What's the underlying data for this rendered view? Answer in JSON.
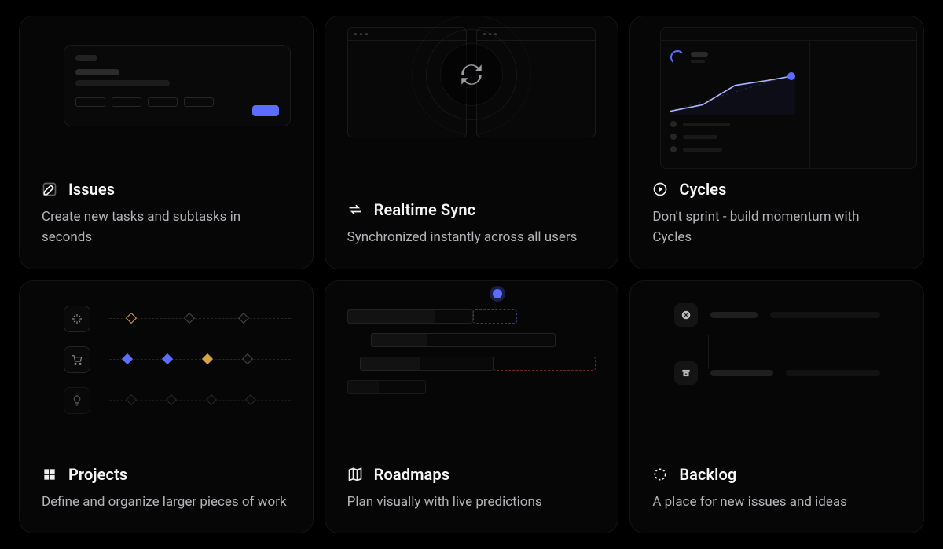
{
  "features": {
    "issues": {
      "title": "Issues",
      "desc": "Create new tasks and subtasks in seconds"
    },
    "realtime": {
      "title": "Realtime Sync",
      "desc": "Synchronized instantly across all users"
    },
    "cycles": {
      "title": "Cycles",
      "desc": "Don't sprint - build momentum with Cycles"
    },
    "projects": {
      "title": "Projects",
      "desc": "Define and organize larger pieces of work"
    },
    "roadmaps": {
      "title": "Roadmaps",
      "desc": "Plan visually with live predictions"
    },
    "backlog": {
      "title": "Backlog",
      "desc": "A place for new issues and ideas"
    }
  }
}
